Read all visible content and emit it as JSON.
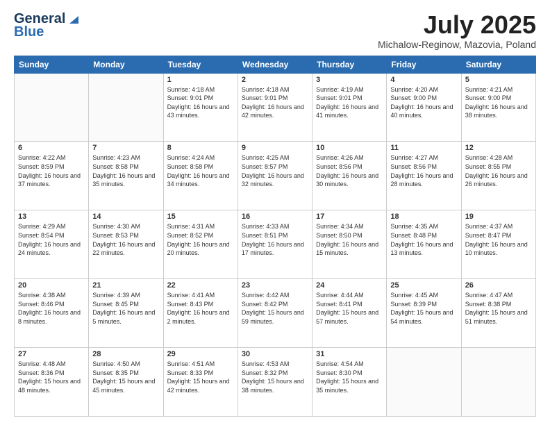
{
  "header": {
    "logo_general": "General",
    "logo_blue": "Blue",
    "title": "July 2025",
    "subtitle": "Michalow-Reginow, Mazovia, Poland"
  },
  "days_of_week": [
    "Sunday",
    "Monday",
    "Tuesday",
    "Wednesday",
    "Thursday",
    "Friday",
    "Saturday"
  ],
  "weeks": [
    [
      {
        "day": "",
        "info": ""
      },
      {
        "day": "",
        "info": ""
      },
      {
        "day": "1",
        "info": "Sunrise: 4:18 AM\nSunset: 9:01 PM\nDaylight: 16 hours and 43 minutes."
      },
      {
        "day": "2",
        "info": "Sunrise: 4:18 AM\nSunset: 9:01 PM\nDaylight: 16 hours and 42 minutes."
      },
      {
        "day": "3",
        "info": "Sunrise: 4:19 AM\nSunset: 9:01 PM\nDaylight: 16 hours and 41 minutes."
      },
      {
        "day": "4",
        "info": "Sunrise: 4:20 AM\nSunset: 9:00 PM\nDaylight: 16 hours and 40 minutes."
      },
      {
        "day": "5",
        "info": "Sunrise: 4:21 AM\nSunset: 9:00 PM\nDaylight: 16 hours and 38 minutes."
      }
    ],
    [
      {
        "day": "6",
        "info": "Sunrise: 4:22 AM\nSunset: 8:59 PM\nDaylight: 16 hours and 37 minutes."
      },
      {
        "day": "7",
        "info": "Sunrise: 4:23 AM\nSunset: 8:58 PM\nDaylight: 16 hours and 35 minutes."
      },
      {
        "day": "8",
        "info": "Sunrise: 4:24 AM\nSunset: 8:58 PM\nDaylight: 16 hours and 34 minutes."
      },
      {
        "day": "9",
        "info": "Sunrise: 4:25 AM\nSunset: 8:57 PM\nDaylight: 16 hours and 32 minutes."
      },
      {
        "day": "10",
        "info": "Sunrise: 4:26 AM\nSunset: 8:56 PM\nDaylight: 16 hours and 30 minutes."
      },
      {
        "day": "11",
        "info": "Sunrise: 4:27 AM\nSunset: 8:56 PM\nDaylight: 16 hours and 28 minutes."
      },
      {
        "day": "12",
        "info": "Sunrise: 4:28 AM\nSunset: 8:55 PM\nDaylight: 16 hours and 26 minutes."
      }
    ],
    [
      {
        "day": "13",
        "info": "Sunrise: 4:29 AM\nSunset: 8:54 PM\nDaylight: 16 hours and 24 minutes."
      },
      {
        "day": "14",
        "info": "Sunrise: 4:30 AM\nSunset: 8:53 PM\nDaylight: 16 hours and 22 minutes."
      },
      {
        "day": "15",
        "info": "Sunrise: 4:31 AM\nSunset: 8:52 PM\nDaylight: 16 hours and 20 minutes."
      },
      {
        "day": "16",
        "info": "Sunrise: 4:33 AM\nSunset: 8:51 PM\nDaylight: 16 hours and 17 minutes."
      },
      {
        "day": "17",
        "info": "Sunrise: 4:34 AM\nSunset: 8:50 PM\nDaylight: 16 hours and 15 minutes."
      },
      {
        "day": "18",
        "info": "Sunrise: 4:35 AM\nSunset: 8:48 PM\nDaylight: 16 hours and 13 minutes."
      },
      {
        "day": "19",
        "info": "Sunrise: 4:37 AM\nSunset: 8:47 PM\nDaylight: 16 hours and 10 minutes."
      }
    ],
    [
      {
        "day": "20",
        "info": "Sunrise: 4:38 AM\nSunset: 8:46 PM\nDaylight: 16 hours and 8 minutes."
      },
      {
        "day": "21",
        "info": "Sunrise: 4:39 AM\nSunset: 8:45 PM\nDaylight: 16 hours and 5 minutes."
      },
      {
        "day": "22",
        "info": "Sunrise: 4:41 AM\nSunset: 8:43 PM\nDaylight: 16 hours and 2 minutes."
      },
      {
        "day": "23",
        "info": "Sunrise: 4:42 AM\nSunset: 8:42 PM\nDaylight: 15 hours and 59 minutes."
      },
      {
        "day": "24",
        "info": "Sunrise: 4:44 AM\nSunset: 8:41 PM\nDaylight: 15 hours and 57 minutes."
      },
      {
        "day": "25",
        "info": "Sunrise: 4:45 AM\nSunset: 8:39 PM\nDaylight: 15 hours and 54 minutes."
      },
      {
        "day": "26",
        "info": "Sunrise: 4:47 AM\nSunset: 8:38 PM\nDaylight: 15 hours and 51 minutes."
      }
    ],
    [
      {
        "day": "27",
        "info": "Sunrise: 4:48 AM\nSunset: 8:36 PM\nDaylight: 15 hours and 48 minutes."
      },
      {
        "day": "28",
        "info": "Sunrise: 4:50 AM\nSunset: 8:35 PM\nDaylight: 15 hours and 45 minutes."
      },
      {
        "day": "29",
        "info": "Sunrise: 4:51 AM\nSunset: 8:33 PM\nDaylight: 15 hours and 42 minutes."
      },
      {
        "day": "30",
        "info": "Sunrise: 4:53 AM\nSunset: 8:32 PM\nDaylight: 15 hours and 38 minutes."
      },
      {
        "day": "31",
        "info": "Sunrise: 4:54 AM\nSunset: 8:30 PM\nDaylight: 15 hours and 35 minutes."
      },
      {
        "day": "",
        "info": ""
      },
      {
        "day": "",
        "info": ""
      }
    ]
  ]
}
